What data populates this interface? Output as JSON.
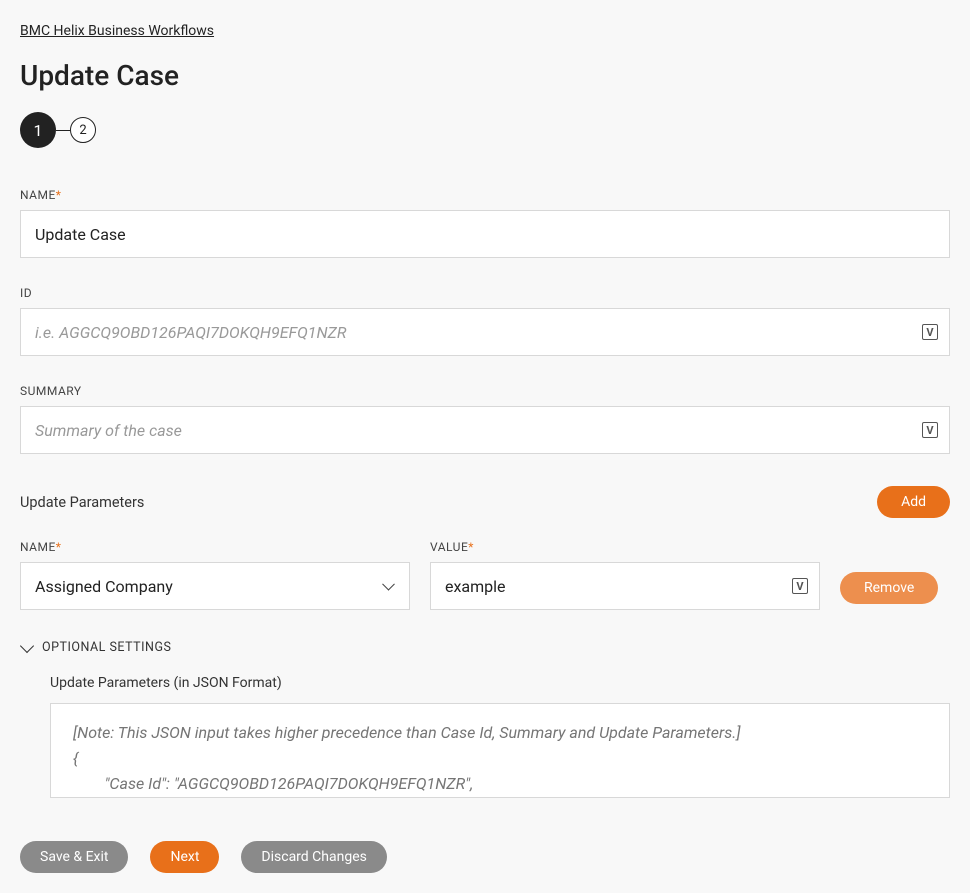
{
  "breadcrumb": "BMC Helix Business Workflows",
  "page_title": "Update Case",
  "steps": {
    "current": "1",
    "next": "2"
  },
  "fields": {
    "name": {
      "label": "NAME",
      "value": "Update Case"
    },
    "id": {
      "label": "ID",
      "placeholder": "i.e. AGGCQ9OBD126PAQI7DOKQH9EFQ1NZR"
    },
    "summary": {
      "label": "SUMMARY",
      "placeholder": "Summary of the case"
    }
  },
  "params": {
    "section_title": "Update Parameters",
    "add_label": "Add",
    "row": {
      "name_label": "NAME",
      "name_value": "Assigned Company",
      "value_label": "VALUE",
      "value_value": "example",
      "remove_label": "Remove"
    }
  },
  "optional": {
    "toggle_label": "OPTIONAL SETTINGS",
    "json_label": "Update Parameters (in JSON Format)",
    "json_placeholder": "[Note: This JSON input takes higher precedence than Case Id, Summary and Update Parameters.]\n{\n        \"Case Id\": \"AGGCQ9OBD126PAQI7DOKQH9EFQ1NZR\","
  },
  "footer": {
    "save_exit": "Save & Exit",
    "next": "Next",
    "discard": "Discard Changes"
  },
  "icons": {
    "variable_glyph": "V"
  }
}
